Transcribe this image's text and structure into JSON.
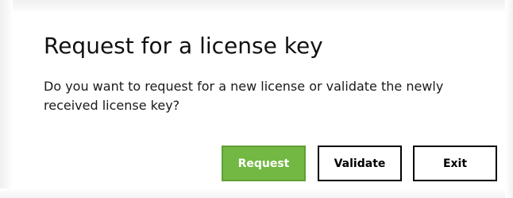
{
  "dialog": {
    "title": "Request for a license key",
    "message": "Do you want to request for a new license or validate the newly received license key?",
    "buttons": {
      "request_label": "Request",
      "validate_label": "Validate",
      "exit_label": "Exit"
    }
  },
  "colors": {
    "primary_button": "#72b842",
    "button_border": "#000000",
    "text": "#111111",
    "background": "#ffffff"
  }
}
